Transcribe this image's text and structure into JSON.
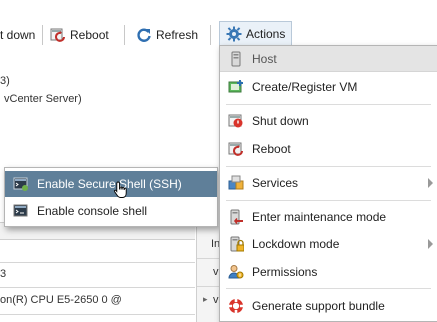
{
  "toolbar": {
    "shutdown_label": "t down",
    "reboot_label": "Reboot",
    "refresh_label": "Refresh",
    "actions_label": "Actions"
  },
  "background": {
    "line1": "3)",
    "line2": "vCenter Server)",
    "row1": "3",
    "row2": "on(R) CPU E5-2650 0 @",
    "right_col": [
      "In",
      "v",
      "v",
      "v"
    ]
  },
  "host_submenu": {
    "items": [
      {
        "label": "Enable Secure Shell (SSH)",
        "icon": "ssh-terminal-icon"
      },
      {
        "label": "Enable console shell",
        "icon": "console-terminal-icon"
      }
    ]
  },
  "actions_menu": {
    "header": "Host",
    "items": [
      {
        "label": "Create/Register VM",
        "icon": "create-vm-icon"
      },
      {
        "label": "Shut down",
        "icon": "shutdown-icon"
      },
      {
        "label": "Reboot",
        "icon": "reboot-icon"
      },
      {
        "label": "Services",
        "icon": "services-icon"
      },
      {
        "label": "Enter maintenance mode",
        "icon": "maintenance-icon"
      },
      {
        "label": "Lockdown mode",
        "icon": "lockdown-icon"
      },
      {
        "label": "Permissions",
        "icon": "permissions-icon"
      },
      {
        "label": "Generate support bundle",
        "icon": "support-bundle-icon"
      }
    ]
  },
  "colors": {
    "highlight": "#5f7f99",
    "header_bg": "#e4e4e4",
    "actions_button_bg": "#eaf1f8"
  }
}
